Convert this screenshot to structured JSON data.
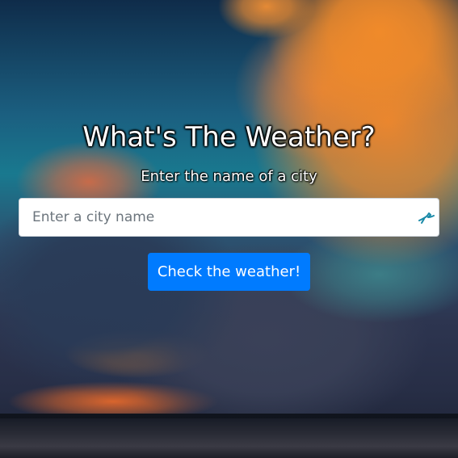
{
  "header": {
    "title": "What's The Weather?",
    "subtitle": "Enter the name of a city"
  },
  "search": {
    "value": "",
    "placeholder": "Enter a city name",
    "icon": "extension-icon"
  },
  "actions": {
    "submit_label": "Check the weather!"
  },
  "colors": {
    "button_bg": "#007bff",
    "button_text": "#ffffff",
    "title_text": "#ffffff",
    "input_bg": "#ffffff",
    "icon_color": "#1a8aa8"
  }
}
